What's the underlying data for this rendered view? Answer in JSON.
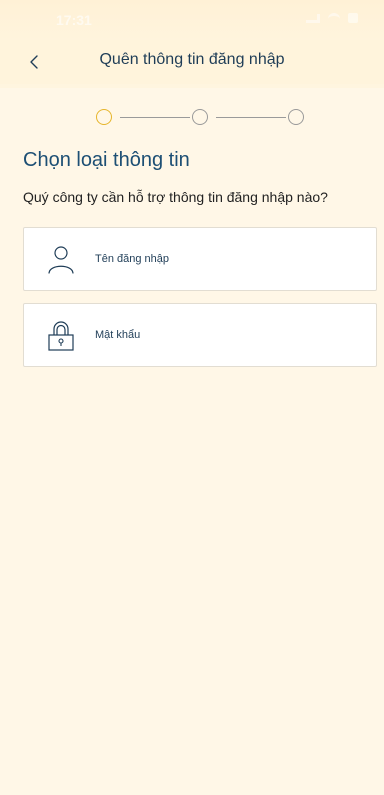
{
  "status_bar": {
    "time": "17:31",
    "icons": [
      "signal-icon",
      "wifi-icon",
      "battery-icon"
    ]
  },
  "nav": {
    "back_icon": "chevron-left-icon",
    "title": "Quên thông tin đăng nhập"
  },
  "stepper": {
    "current_step": 1,
    "total_steps": 3,
    "active_color": "#e6b52c",
    "inactive_color": "#9a9a9a"
  },
  "main": {
    "title": "Chọn loại thông tin",
    "subtitle": "Quý công ty cần hỗ trợ thông tin đăng nhập nào?",
    "options": [
      {
        "label": "Tên đăng nhập",
        "icon": "user-icon"
      },
      {
        "label": "Mật khẩu",
        "icon": "lock-icon"
      }
    ]
  },
  "colors": {
    "background": "#fff7e7",
    "title": "#1d4f74",
    "text": "#1f3d57"
  }
}
